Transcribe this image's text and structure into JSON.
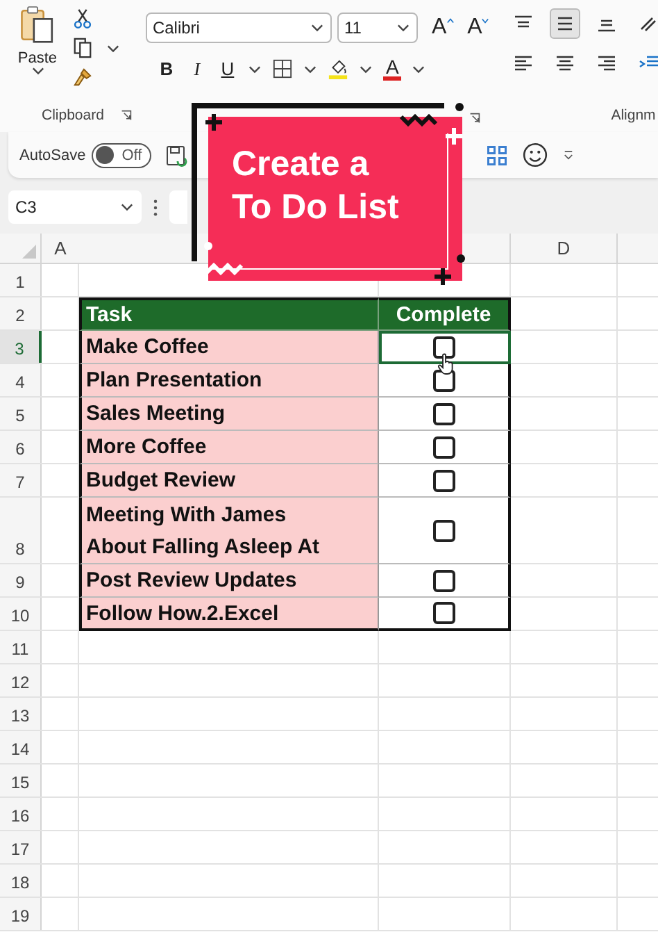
{
  "ribbon": {
    "clipboard": {
      "paste_label": "Paste",
      "group_label": "Clipboard"
    },
    "font": {
      "font_name": "Calibri",
      "font_size": "11",
      "size_buttons": [
        "A",
        "A"
      ],
      "style_buttons": [
        "B",
        "I",
        "U"
      ],
      "font_color_button": "A"
    },
    "alignment": {
      "group_label": "Alignm"
    }
  },
  "quick_access": {
    "autosave_label": "AutoSave",
    "autosave_toggle": {
      "label": "Off",
      "on": false
    }
  },
  "formula_bar": {
    "name_box": "C3"
  },
  "column_headers": [
    "A",
    "D"
  ],
  "row_headers": [
    {
      "label": "1",
      "selected": false
    },
    {
      "label": "2",
      "selected": false
    },
    {
      "label": "3",
      "selected": true
    },
    {
      "label": "4",
      "selected": false
    },
    {
      "label": "5",
      "selected": false
    },
    {
      "label": "6",
      "selected": false
    },
    {
      "label": "7",
      "selected": false
    },
    {
      "label": "8",
      "selected": false
    },
    {
      "label": "9",
      "selected": false
    },
    {
      "label": "10",
      "selected": false
    },
    {
      "label": "11",
      "selected": false
    },
    {
      "label": "12",
      "selected": false
    },
    {
      "label": "13",
      "selected": false
    },
    {
      "label": "14",
      "selected": false
    },
    {
      "label": "15",
      "selected": false
    },
    {
      "label": "16",
      "selected": false
    },
    {
      "label": "17",
      "selected": false
    },
    {
      "label": "18",
      "selected": false
    },
    {
      "label": "19",
      "selected": false
    }
  ],
  "table": {
    "columns": [
      "Task",
      "Complete"
    ],
    "rows": [
      {
        "task": "Make Coffee",
        "checked": false,
        "selected": true
      },
      {
        "task": "Plan Presentation",
        "checked": false,
        "selected": false
      },
      {
        "task": "Sales Meeting",
        "checked": false,
        "selected": false
      },
      {
        "task": "More Coffee",
        "checked": false,
        "selected": false
      },
      {
        "task": "Budget Review",
        "checked": false,
        "selected": false
      },
      {
        "task": "Meeting With James\nAbout Falling Asleep At",
        "checked": false,
        "selected": false
      },
      {
        "task": "Post Review Updates",
        "checked": false,
        "selected": false
      },
      {
        "task": "Follow How.2.Excel",
        "checked": false,
        "selected": false
      }
    ]
  },
  "title_card": {
    "lines": [
      "Create a",
      "To Do List"
    ]
  }
}
